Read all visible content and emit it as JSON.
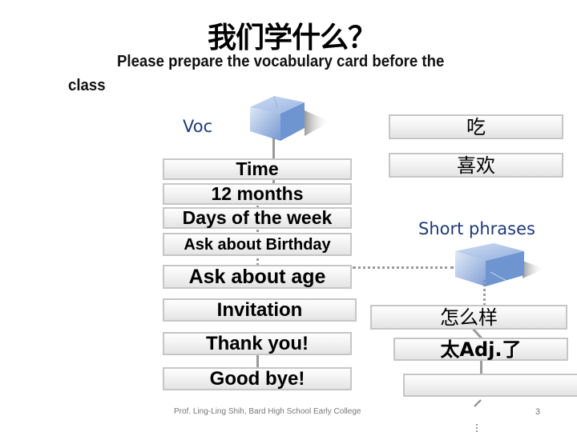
{
  "slide": {
    "title": "我们学什么？",
    "subtitle_line1": "Please prepare the vocabulary card before the",
    "subtitle_line2": "class",
    "footer": "Prof. Ling-Ling Shih, Bard High School Early College",
    "page_number": "3"
  },
  "diagram": {
    "left_branch": {
      "node_label": "Voc",
      "node_icon": "cube-icon",
      "items": [
        {
          "label": "Time"
        },
        {
          "label": "12 months"
        },
        {
          "label": "Days of the week"
        },
        {
          "label": "Ask about Birthday"
        },
        {
          "label": "Ask about age"
        },
        {
          "label": "Invitation"
        },
        {
          "label": "Thank you!"
        },
        {
          "label": "Good bye!"
        }
      ]
    },
    "right_top_items": [
      {
        "label": "吃"
      },
      {
        "label": "喜欢"
      }
    ],
    "right_branch": {
      "node_label": "Short phrases",
      "node_icon": "cube-icon",
      "items": [
        {
          "label": "怎么样"
        },
        {
          "label": "太Adj.了"
        },
        {
          "label": ""
        }
      ]
    },
    "colors": {
      "node_label": "#1f3a78",
      "cube": "#6f95d0",
      "box_border": "#c6c6c6",
      "connector": "#9a9a9a"
    }
  }
}
